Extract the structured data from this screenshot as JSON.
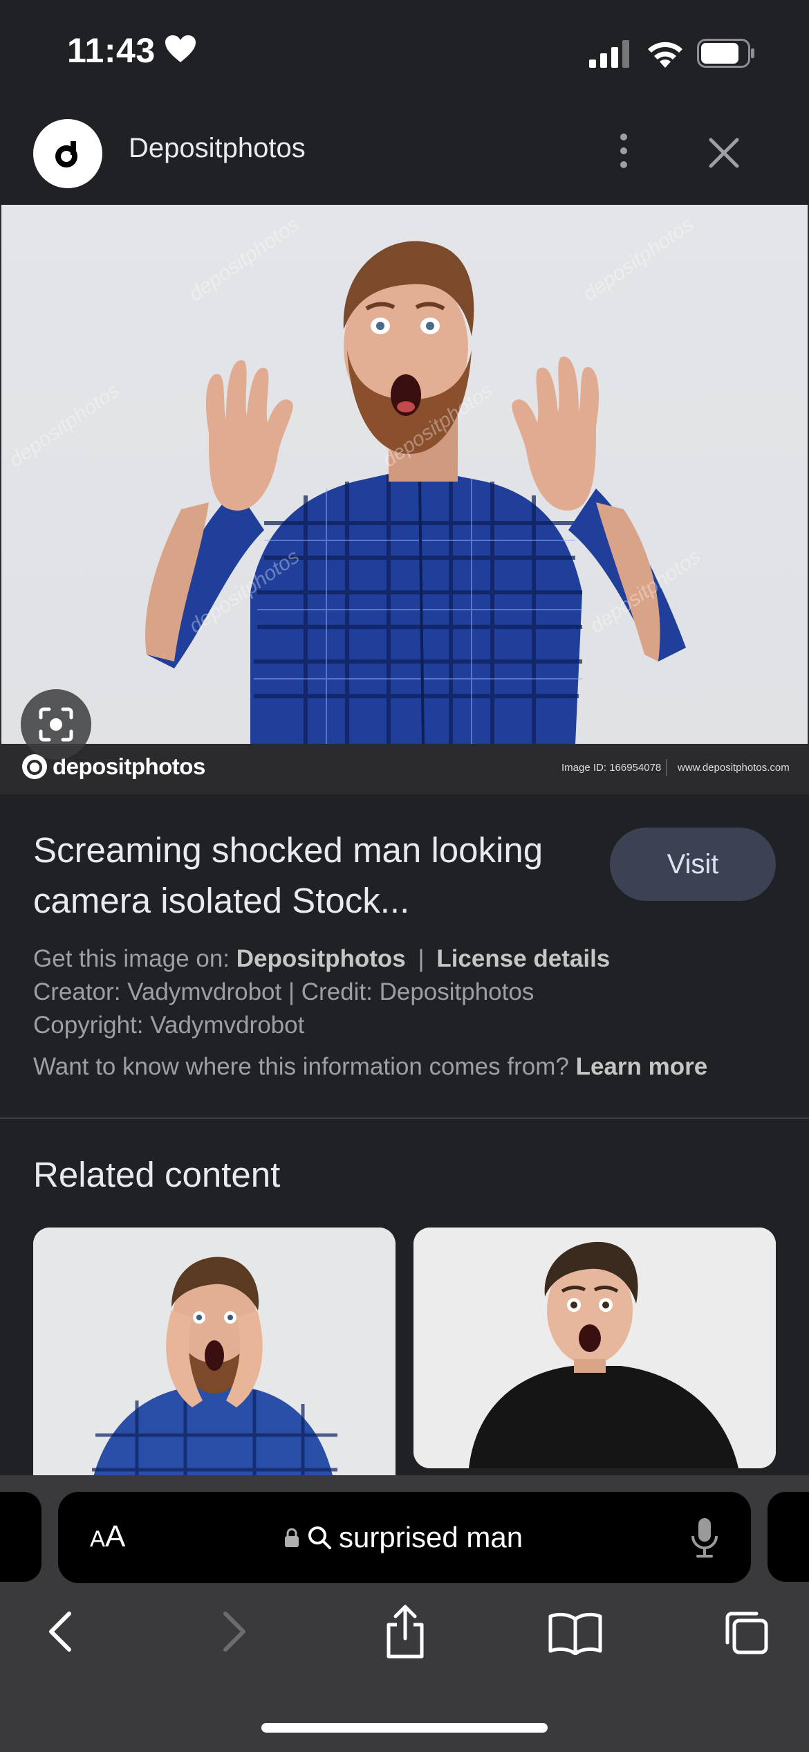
{
  "status_bar": {
    "time": "11:43"
  },
  "header": {
    "site_name": "Depositphotos",
    "logo_letter": "d"
  },
  "image": {
    "watermark_brand": "depositphotos",
    "image_id": "Image ID: 166954078",
    "site_url": "www.depositphotos.com"
  },
  "result": {
    "title": "Screaming shocked man looking camera isolated Stock...",
    "visit_label": "Visit",
    "get_image_prefix": "Get this image on:",
    "get_image_source": "Depositphotos",
    "separator": "|",
    "license_details": "License details",
    "creator_line": "Creator: Vadymvdrobot | Credit: Depositphotos",
    "copyright_line": "Copyright: Vadymvdrobot",
    "info_question": "Want to know where this information comes from?",
    "learn_more": "Learn more"
  },
  "related": {
    "title": "Related content"
  },
  "browser": {
    "aa_label_big": "A",
    "aa_label_small": "A",
    "url_text": "surprised man"
  },
  "colors": {
    "background": "#202124",
    "visit_button": "#3c4253",
    "toolbar": "#3a3a3c"
  }
}
